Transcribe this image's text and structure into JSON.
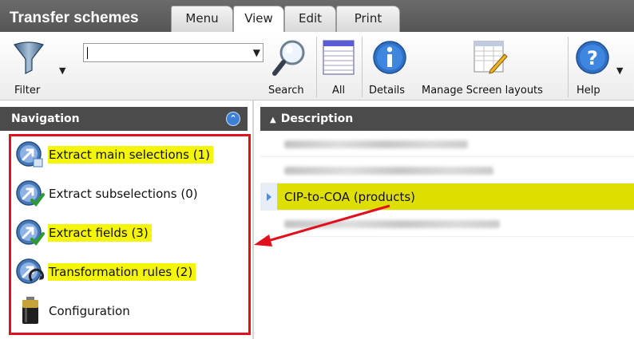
{
  "app": {
    "title": "Transfer schemes"
  },
  "tabs": [
    {
      "label": "Menu",
      "active": false
    },
    {
      "label": "View",
      "active": true
    },
    {
      "label": "Edit",
      "active": false
    },
    {
      "label": "Print",
      "active": false
    }
  ],
  "ribbon": {
    "filter_label": "Filter",
    "search_value": "",
    "search_label": "Search",
    "all_label": "All",
    "details_label": "Details",
    "layouts_label": "Manage Screen layouts",
    "help_label": "Help"
  },
  "navigation": {
    "title": "Navigation",
    "items": [
      {
        "label": "Extract main selections (1)",
        "icon": "extract-main-icon",
        "highlighted": true
      },
      {
        "label": "Extract subselections (0)",
        "icon": "extract-sub-icon",
        "highlighted": false
      },
      {
        "label": "Extract fields (3)",
        "icon": "extract-fields-icon",
        "highlighted": true
      },
      {
        "label": "Transformation rules (2)",
        "icon": "transformation-icon",
        "highlighted": true
      },
      {
        "label": "Configuration",
        "icon": "battery-icon",
        "highlighted": false
      }
    ]
  },
  "grid": {
    "column_header": "Description",
    "rows": [
      {
        "text": "",
        "blurred": true
      },
      {
        "text": "",
        "blurred": true
      },
      {
        "text": "CIP-to-COA (products)",
        "blurred": false,
        "selected": true
      },
      {
        "text": "",
        "blurred": true
      }
    ]
  },
  "colors": {
    "highlight": "#f5f50a",
    "selected_row": "#dede00",
    "annotation": "#e0101e",
    "header_bg": "#4b4b4b"
  }
}
